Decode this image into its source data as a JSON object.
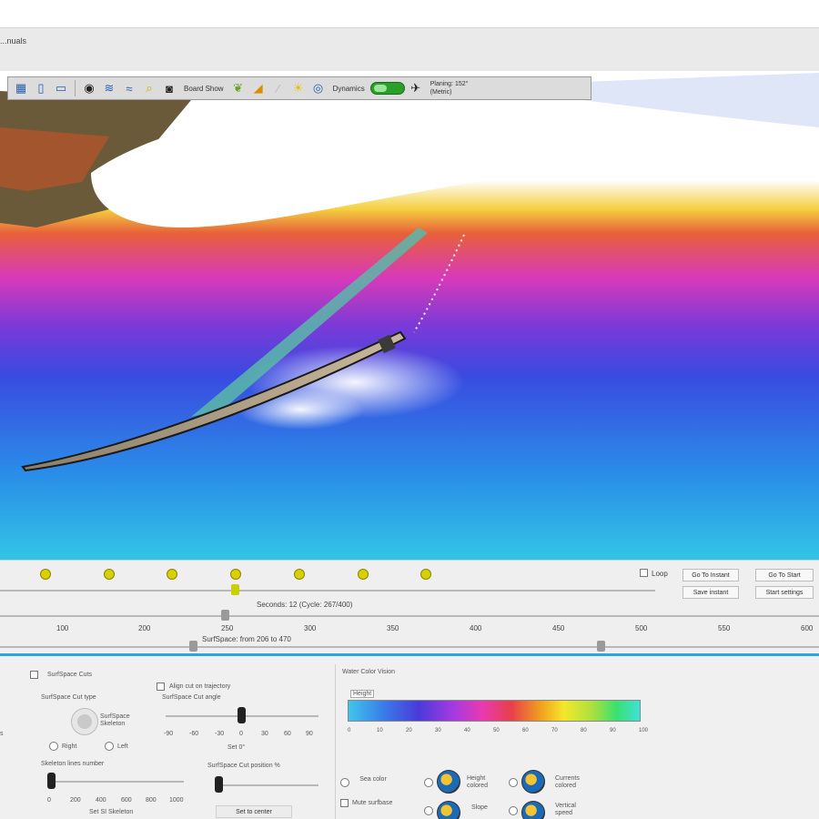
{
  "window": {
    "title": "...nuals"
  },
  "toolbar": {
    "board_show_label": "Board Show",
    "dynamics_label": "Dynamics",
    "planing_line1": "Planing: 152°",
    "planing_line2": "(Metric)"
  },
  "timeline": {
    "seconds_caption": "Seconds: 12 (Cycle: 267/400)",
    "loop_label": "Loop",
    "goto_instant_label": "Go To Instant",
    "goto_start_label": "Go To Start",
    "save_instant_label": "Save instant",
    "start_settings_label": "Start settings",
    "ticks": [
      "100",
      "200",
      "250",
      "300",
      "350",
      "400",
      "450",
      "500",
      "550",
      "600"
    ],
    "surf_span_caption": "SurfSpace: from 206 to 470",
    "seconds_progress": 0.27
  },
  "controls": {
    "surfspace_cuts_label": "SurfSpace Cuts",
    "surfspace_cut_type": "SurfSpace Cut type",
    "surfspace_skeleton": "SurfSpace Skeleton",
    "right_label": "Right",
    "left_label": "Left",
    "skeleton_lines_label": "Skeleton lines number",
    "skeleton_scale": [
      "0",
      "200",
      "400",
      "600",
      "800",
      "1000"
    ],
    "set_skeleton_label": "Set SI Skeleton",
    "align_cut_label": "Align cut on trajectory",
    "cut_angle_label": "SurfSpace Cut angle",
    "angle_scale": [
      "-90",
      "-60",
      "-30",
      "0",
      "30",
      "60",
      "90"
    ],
    "set_angle_label": "Set 0°",
    "cut_position_label": "SurfSpace Cut position %",
    "set_center_label": "Set to center",
    "water_color_label": "Water Color Vision",
    "height_tag": "Height",
    "color_scale": [
      "0",
      "10",
      "20",
      "30",
      "40",
      "50",
      "60",
      "70",
      "80",
      "90",
      "100"
    ],
    "sea_color_label": "Sea color",
    "mute_surfbase_label": "Mute surfbase",
    "height_colored_label": "Height colored",
    "currents_colored_label": "Currents colored",
    "slope_label": "Slope",
    "vertical_speed_label": "Vertical speed"
  },
  "colors": {
    "accent_divider": "#29a8e0",
    "toggle_green": "#2aa02a",
    "transport_yellow": "#d8d000"
  }
}
